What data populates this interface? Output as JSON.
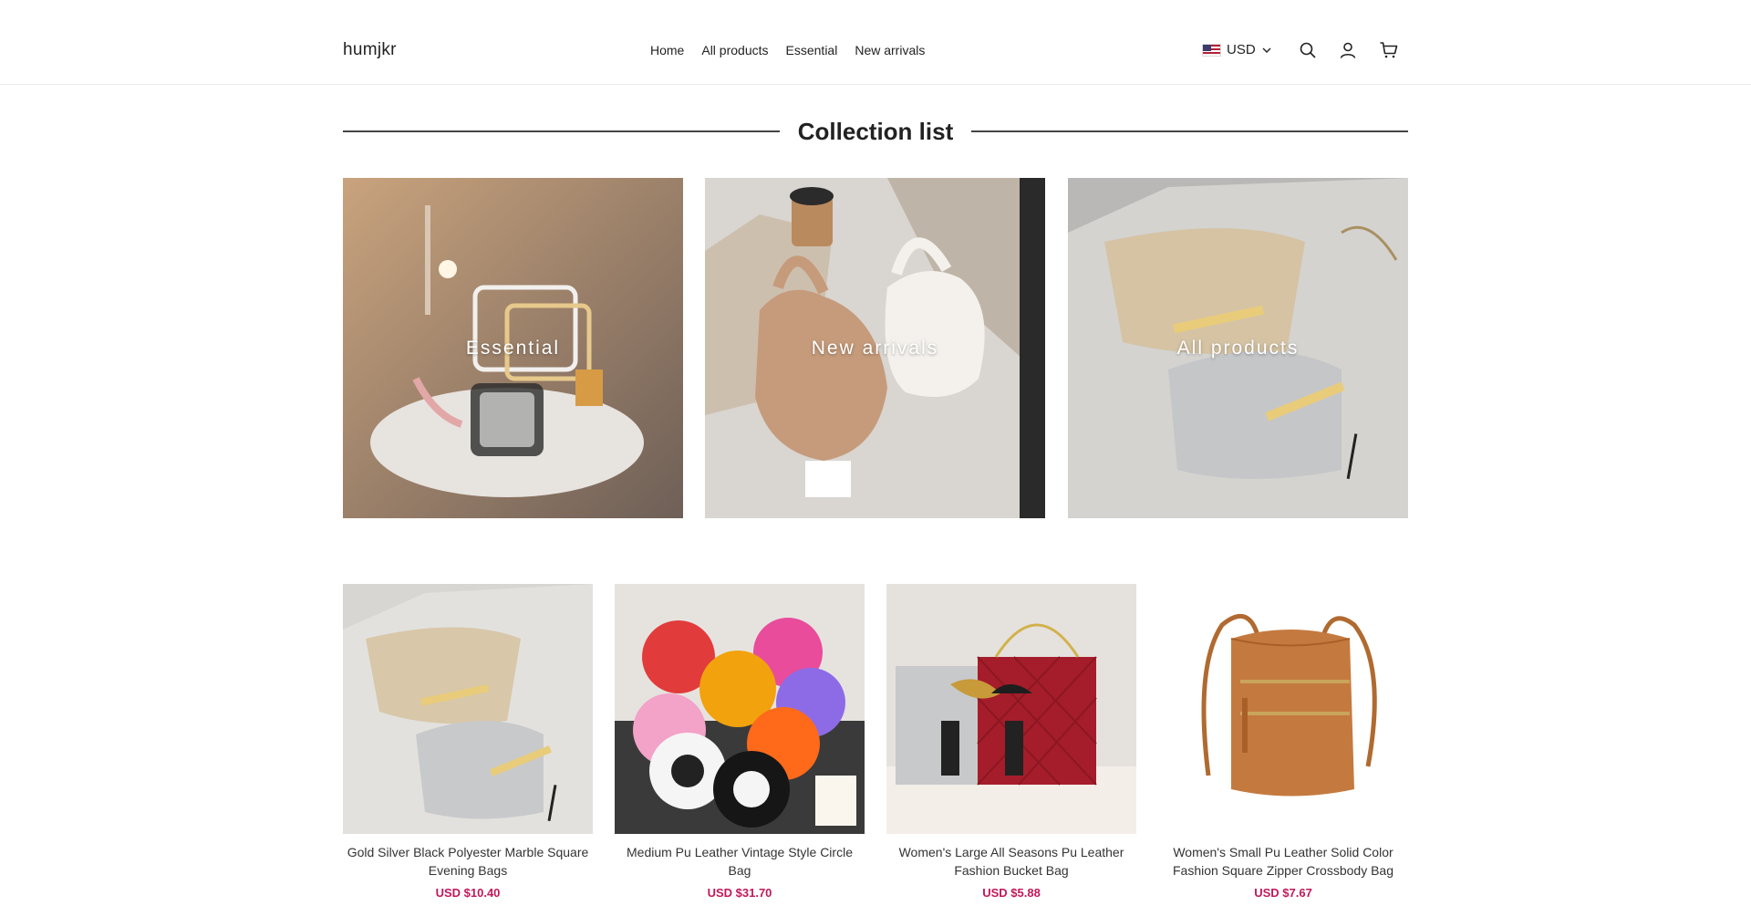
{
  "header": {
    "logo": "humjkr",
    "nav": [
      "Home",
      "All products",
      "Essential",
      "New arrivals"
    ],
    "currency": "USD"
  },
  "collections": {
    "title": "Collection list",
    "items": [
      {
        "label": "Essential"
      },
      {
        "label": "New arrivals"
      },
      {
        "label": "All products"
      }
    ]
  },
  "products": [
    {
      "title": "Gold Silver Black Polyester Marble Square Evening Bags",
      "price": "USD $10.40"
    },
    {
      "title": "Medium Pu Leather Vintage Style Circle Bag",
      "price": "USD $31.70"
    },
    {
      "title": "Women's Large All Seasons Pu Leather Fashion Bucket Bag",
      "price": "USD $5.88"
    },
    {
      "title": "Women's Small Pu Leather Solid Color Fashion Square Zipper Crossbody Bag",
      "price": "USD $7.67"
    }
  ],
  "colors": {
    "price": "#c2185b",
    "text": "#222222",
    "rule": "#444444"
  },
  "icons": [
    "chevron-down-icon",
    "search-icon",
    "account-icon",
    "cart-icon"
  ]
}
